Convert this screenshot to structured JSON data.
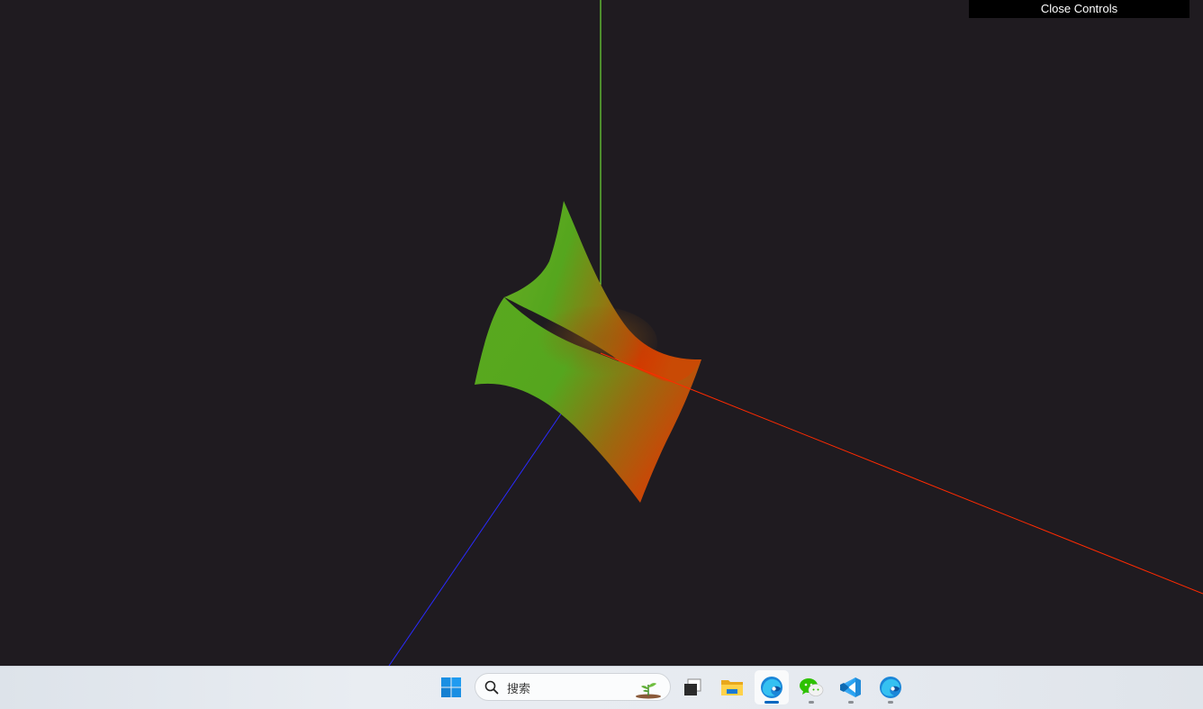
{
  "controls": {
    "close_label": "Close Controls"
  },
  "scene": {
    "background_color": "#1f1b20",
    "axes": {
      "x_color": "#ff2a00",
      "y_color": "#7cff3a",
      "z_color": "#2a2aff"
    },
    "surface": {
      "shape": "hyperbolic-paraboloid",
      "color_low": "#55a61e",
      "color_high": "#d23a00"
    }
  },
  "taskbar": {
    "search_placeholder": "搜索",
    "items": [
      {
        "icon": "windows-start-icon"
      },
      {
        "icon": "task-view-icon"
      },
      {
        "icon": "file-explorer-icon"
      },
      {
        "icon": "edge-icon",
        "state": "focused"
      },
      {
        "icon": "wechat-icon",
        "state": "running"
      },
      {
        "icon": "vscode-icon",
        "state": "running"
      },
      {
        "icon": "edge-icon",
        "state": "running"
      }
    ]
  }
}
